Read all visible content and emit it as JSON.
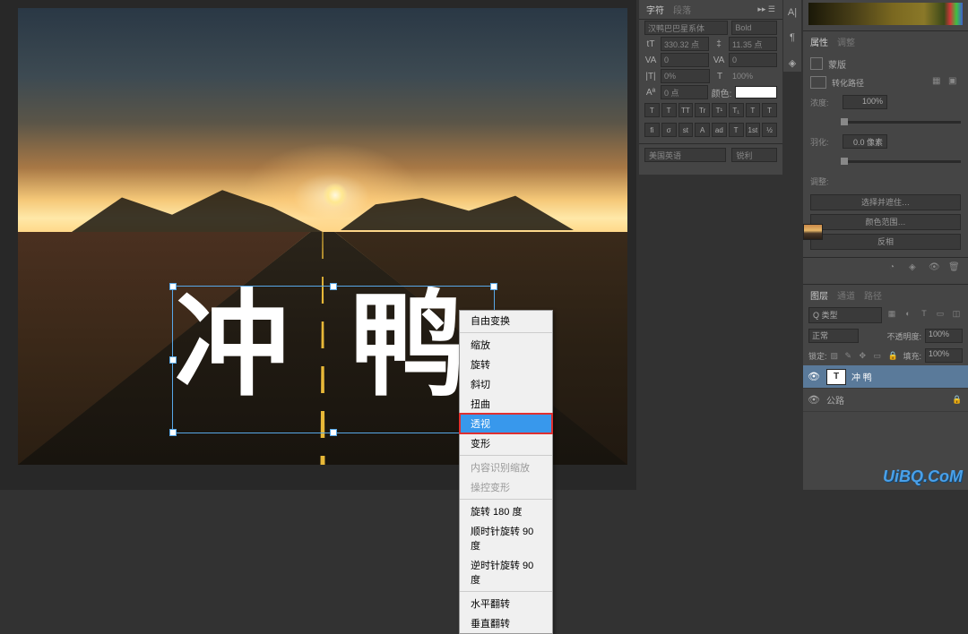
{
  "canvas": {
    "text_content": "冲 鸭"
  },
  "context_menu": {
    "items": [
      {
        "label": "自由变换",
        "type": "item"
      },
      {
        "type": "sep"
      },
      {
        "label": "缩放",
        "type": "item"
      },
      {
        "label": "旋转",
        "type": "item"
      },
      {
        "label": "斜切",
        "type": "item"
      },
      {
        "label": "扭曲",
        "type": "item"
      },
      {
        "label": "透视",
        "type": "hl"
      },
      {
        "label": "变形",
        "type": "item"
      },
      {
        "type": "sep"
      },
      {
        "label": "内容识别缩放",
        "type": "disabled"
      },
      {
        "label": "操控变形",
        "type": "disabled"
      },
      {
        "type": "sep"
      },
      {
        "label": "旋转 180 度",
        "type": "item"
      },
      {
        "label": "顺时针旋转 90 度",
        "type": "item"
      },
      {
        "label": "逆时针旋转 90 度",
        "type": "item"
      },
      {
        "type": "sep"
      },
      {
        "label": "水平翻转",
        "type": "item"
      },
      {
        "label": "垂直翻转",
        "type": "item"
      }
    ]
  },
  "char_panel": {
    "tabs": {
      "active": "字符",
      "inactive": "段落"
    },
    "font_family": "汉鸭巴巴星系体",
    "font_style": "Bold",
    "size": "330.32 点",
    "leading": "11.35 点",
    "va": "0",
    "tracking": "0",
    "vscale": "0%",
    "hscale_label": "T",
    "hscale": "100%",
    "baseline_label": "Aª",
    "baseline": "0 点",
    "color_label": "颜色:",
    "style_btns": [
      "T",
      "T",
      "TT",
      "Tr",
      "T¹",
      "T₁",
      "T",
      "T"
    ],
    "ot_btns": [
      "fi",
      "σ",
      "st",
      "A",
      "ad",
      "T",
      "1st",
      "½"
    ],
    "lang": "美国英语",
    "aa": "锐利"
  },
  "collapsed": {
    "i1": "A|",
    "i2": "¶",
    "i3": "◈"
  },
  "props_panel": {
    "tabs": {
      "t1": "属性",
      "t2": "调整"
    },
    "title": "蒙版",
    "path_label": "转化路径",
    "density_label": "浓度:",
    "density_val": "100%",
    "feather_label": "羽化:",
    "feather_val": "0.0 像素",
    "refine_label": "调整:",
    "btn1": "选择并遮住…",
    "btn2": "颜色范围…",
    "btn3": "反相"
  },
  "layers_panel": {
    "tabs": {
      "t1": "图层",
      "t2": "通道",
      "t3": "路径"
    },
    "search_mode": "Q 类型",
    "blend": "正常",
    "opacity_label": "不透明度:",
    "opacity_val": "100%",
    "lock_label": "锁定:",
    "fill_label": "填充:",
    "fill_val": "100%",
    "layers": [
      {
        "name": "冲 鸭",
        "type": "text",
        "selected": true,
        "locked": false
      },
      {
        "name": "公路",
        "type": "image",
        "selected": false,
        "locked": true
      }
    ]
  },
  "watermark": "UiBQ.CoM"
}
